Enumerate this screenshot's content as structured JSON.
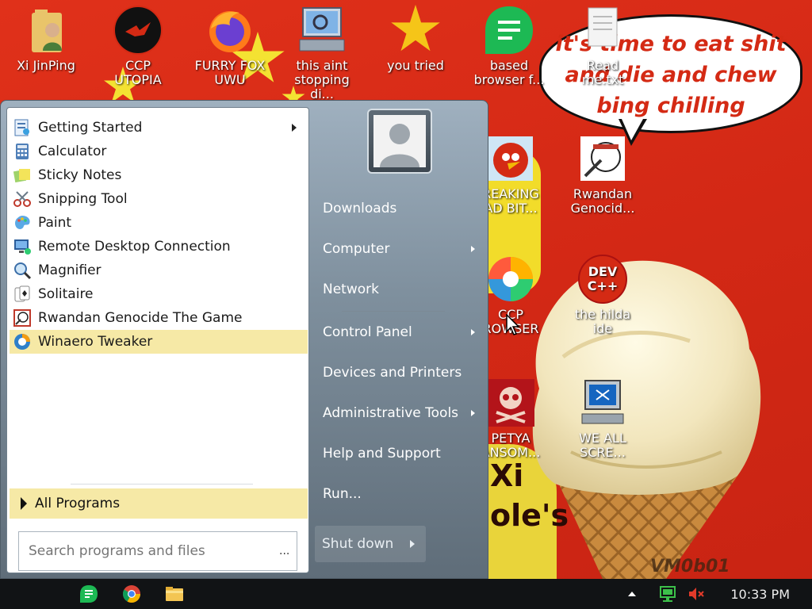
{
  "desktop": {
    "icons": [
      {
        "id": "xi",
        "label": "Xi JinPing"
      },
      {
        "id": "ccp-utopia",
        "label": "CCP UTOPIA"
      },
      {
        "id": "furry-fox",
        "label": "FURRY FOX UWU"
      },
      {
        "id": "stopping",
        "label": "this aint stopping di..."
      },
      {
        "id": "you-tried",
        "label": "you tried"
      },
      {
        "id": "based-browser",
        "label": "based browser f..."
      },
      {
        "id": "readme",
        "label": "Read me.txt"
      },
      {
        "id": "breaking-bad",
        "label": "REAKING AD BIT..."
      },
      {
        "id": "rwandan",
        "label": "Rwandan Genocid..."
      },
      {
        "id": "ccp-browser",
        "label": "CCP ROWSER"
      },
      {
        "id": "devcpp",
        "label": "the hilda ide"
      },
      {
        "id": "petya",
        "label": "PETYA ANSOM..."
      },
      {
        "id": "we-all-scream",
        "label": "WE ALL SCRE..."
      }
    ],
    "bubble_text": "it's time to eat shit and die and chew bing chilling",
    "wallpaper_text_1": "Xi",
    "wallpaper_text_2": "ole's",
    "watermark": "VM0b01",
    "colors": {
      "wallpaper": "#d42a14",
      "highlight": "#f6e9a6"
    }
  },
  "start_menu": {
    "programs": [
      {
        "label": "Getting Started",
        "icon": "getting-started-icon",
        "has_submenu": true
      },
      {
        "label": "Calculator",
        "icon": "calculator-icon"
      },
      {
        "label": "Sticky Notes",
        "icon": "sticky-notes-icon"
      },
      {
        "label": "Snipping Tool",
        "icon": "scissors-icon"
      },
      {
        "label": "Paint",
        "icon": "paint-palette-icon"
      },
      {
        "label": "Remote Desktop Connection",
        "icon": "remote-desktop-icon"
      },
      {
        "label": "Magnifier",
        "icon": "magnifier-icon"
      },
      {
        "label": "Solitaire",
        "icon": "solitaire-icon"
      },
      {
        "label": "Rwandan Genocide The Game",
        "icon": "game-icon"
      },
      {
        "label": "Winaero Tweaker",
        "icon": "winaero-icon",
        "highlighted": true
      }
    ],
    "all_programs": "All Programs",
    "search_placeholder": "Search programs and files",
    "search_more": "...",
    "right_items": [
      {
        "label": "Downloads"
      },
      {
        "label": "Computer",
        "has_submenu": true
      },
      {
        "label": "Network"
      },
      {
        "label": "Control Panel",
        "has_submenu": true
      },
      {
        "label": "Devices and Printers"
      },
      {
        "label": "Administrative Tools",
        "has_submenu": true
      },
      {
        "label": "Help and Support"
      },
      {
        "label": "Run..."
      }
    ],
    "shutdown": "Shut down"
  },
  "taskbar": {
    "pinned": [
      {
        "id": "based-browser",
        "icon": "green-note-icon"
      },
      {
        "id": "chrome",
        "icon": "chrome-icon"
      },
      {
        "id": "explorer",
        "icon": "folder-icon"
      }
    ],
    "tray": [
      {
        "icon": "show-hidden-icons-icon"
      },
      {
        "icon": "network-icon"
      },
      {
        "icon": "volume-muted-icon"
      }
    ],
    "clock": "10:33 PM"
  }
}
